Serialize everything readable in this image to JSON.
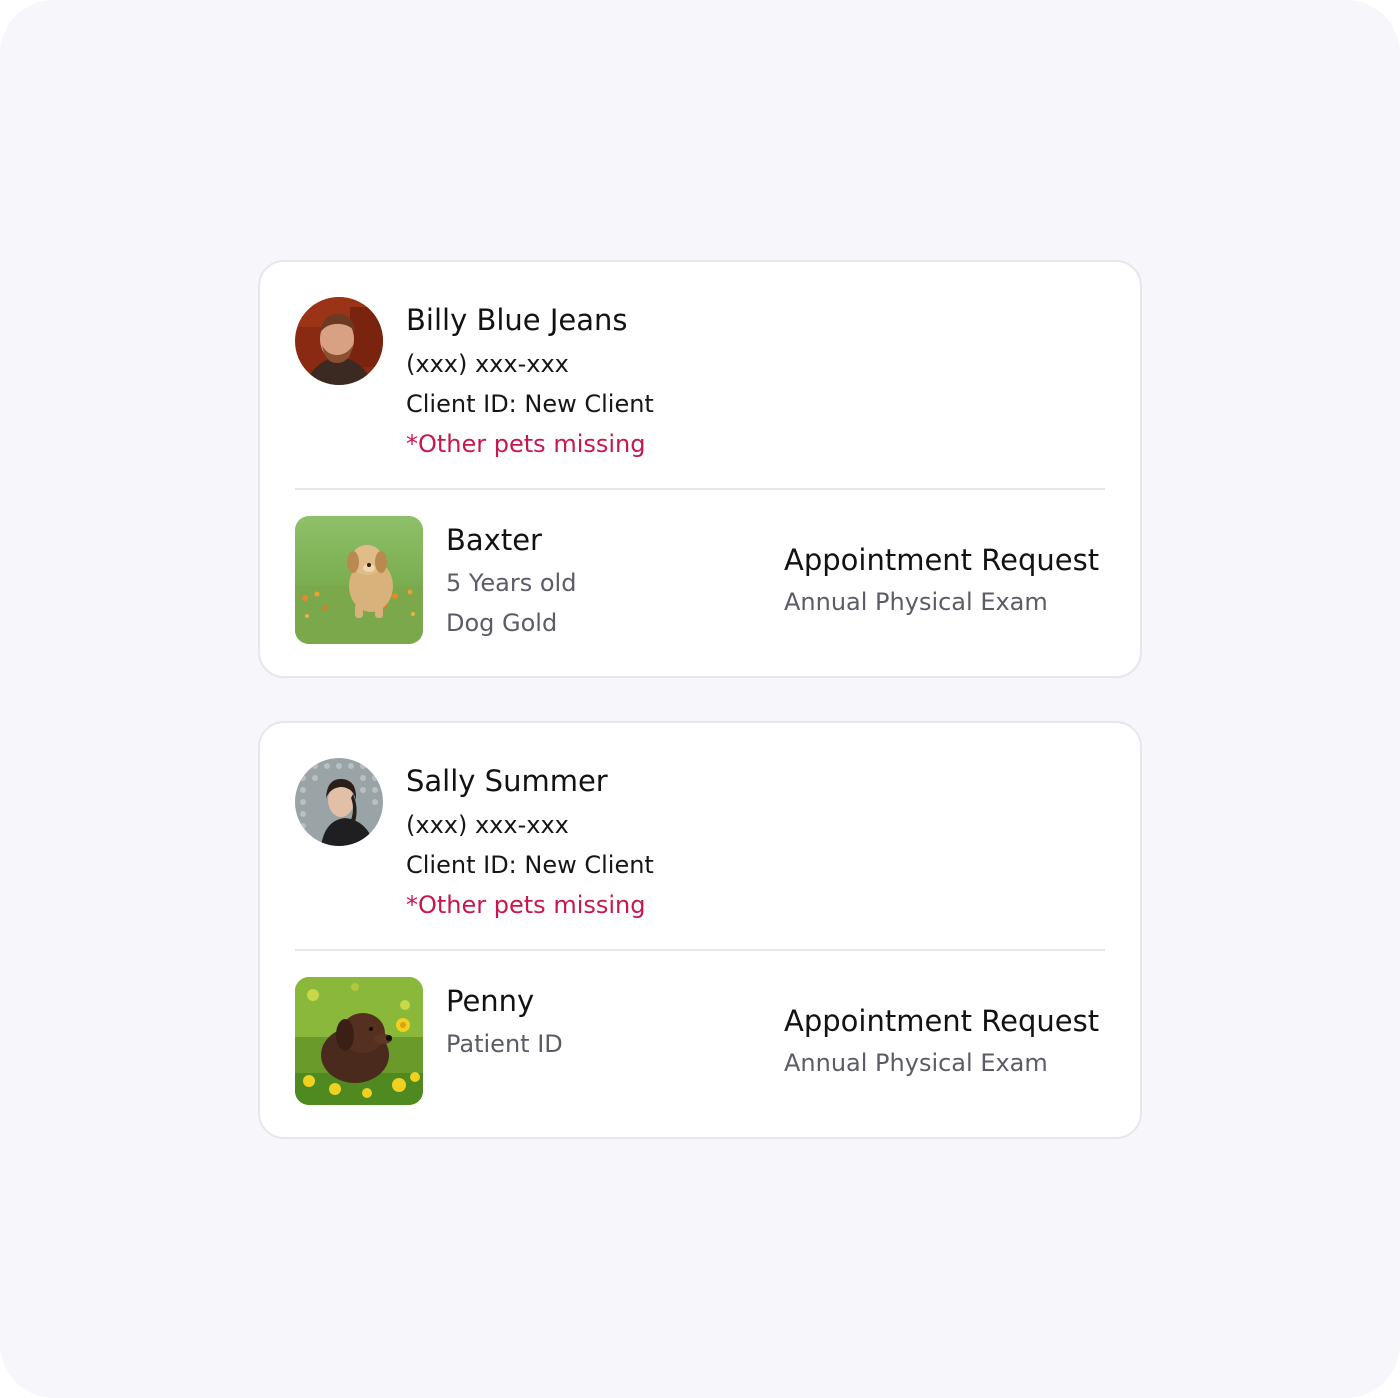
{
  "cards": [
    {
      "client": {
        "name": "Billy Blue Jeans",
        "phone": "(xxx) xxx-xxx",
        "client_id": "Client ID: New Client",
        "missing_note": "*Other pets missing"
      },
      "pet": {
        "name": "Baxter",
        "lines": [
          "5 Years old",
          "Dog Gold"
        ]
      },
      "appointment": {
        "title": "Appointment Request",
        "type": "Annual Physical Exam"
      }
    },
    {
      "client": {
        "name": "Sally Summer",
        "phone": "(xxx) xxx-xxx",
        "client_id": "Client ID: New Client",
        "missing_note": "*Other pets missing"
      },
      "pet": {
        "name": "Penny",
        "lines": [
          "Patient ID"
        ]
      },
      "appointment": {
        "title": "Appointment Request",
        "type": "Annual Physical Exam"
      }
    }
  ],
  "colors": {
    "background": "#f6f6fb",
    "card": "#ffffff",
    "warning": "#c8174d",
    "secondary_text": "#5c5b66"
  }
}
